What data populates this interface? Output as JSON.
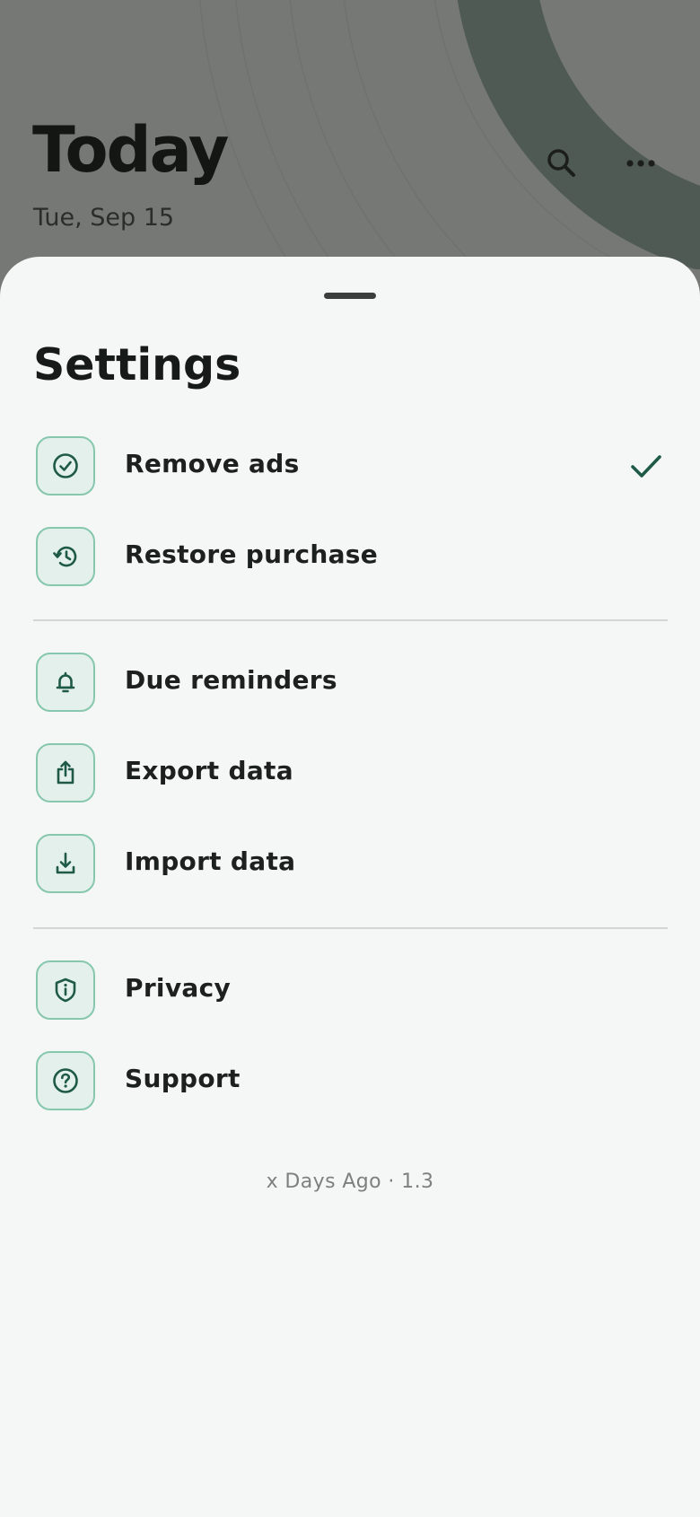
{
  "background": {
    "title": "Today",
    "date": "Tue, Sep 15",
    "icons": [
      "search-icon",
      "more-icon"
    ]
  },
  "sheet": {
    "title": "Settings",
    "groups": [
      {
        "items": [
          {
            "label": "Remove ads",
            "icon": "check-circle-icon",
            "checked": true
          },
          {
            "label": "Restore purchase",
            "icon": "history-icon"
          }
        ]
      },
      {
        "items": [
          {
            "label": "Due reminders",
            "icon": "bell-icon"
          },
          {
            "label": "Export data",
            "icon": "share-icon"
          },
          {
            "label": "Import data",
            "icon": "download-icon"
          }
        ]
      },
      {
        "items": [
          {
            "label": "Privacy",
            "icon": "shield-icon"
          },
          {
            "label": "Support",
            "icon": "help-icon"
          }
        ]
      }
    ],
    "footer": "x Days Ago · 1.3"
  },
  "colors": {
    "accent": "#1f5a48",
    "icon_border": "#86c7ad",
    "icon_bg": "#e4f0eb",
    "sheet_bg": "#f5f7f6"
  }
}
